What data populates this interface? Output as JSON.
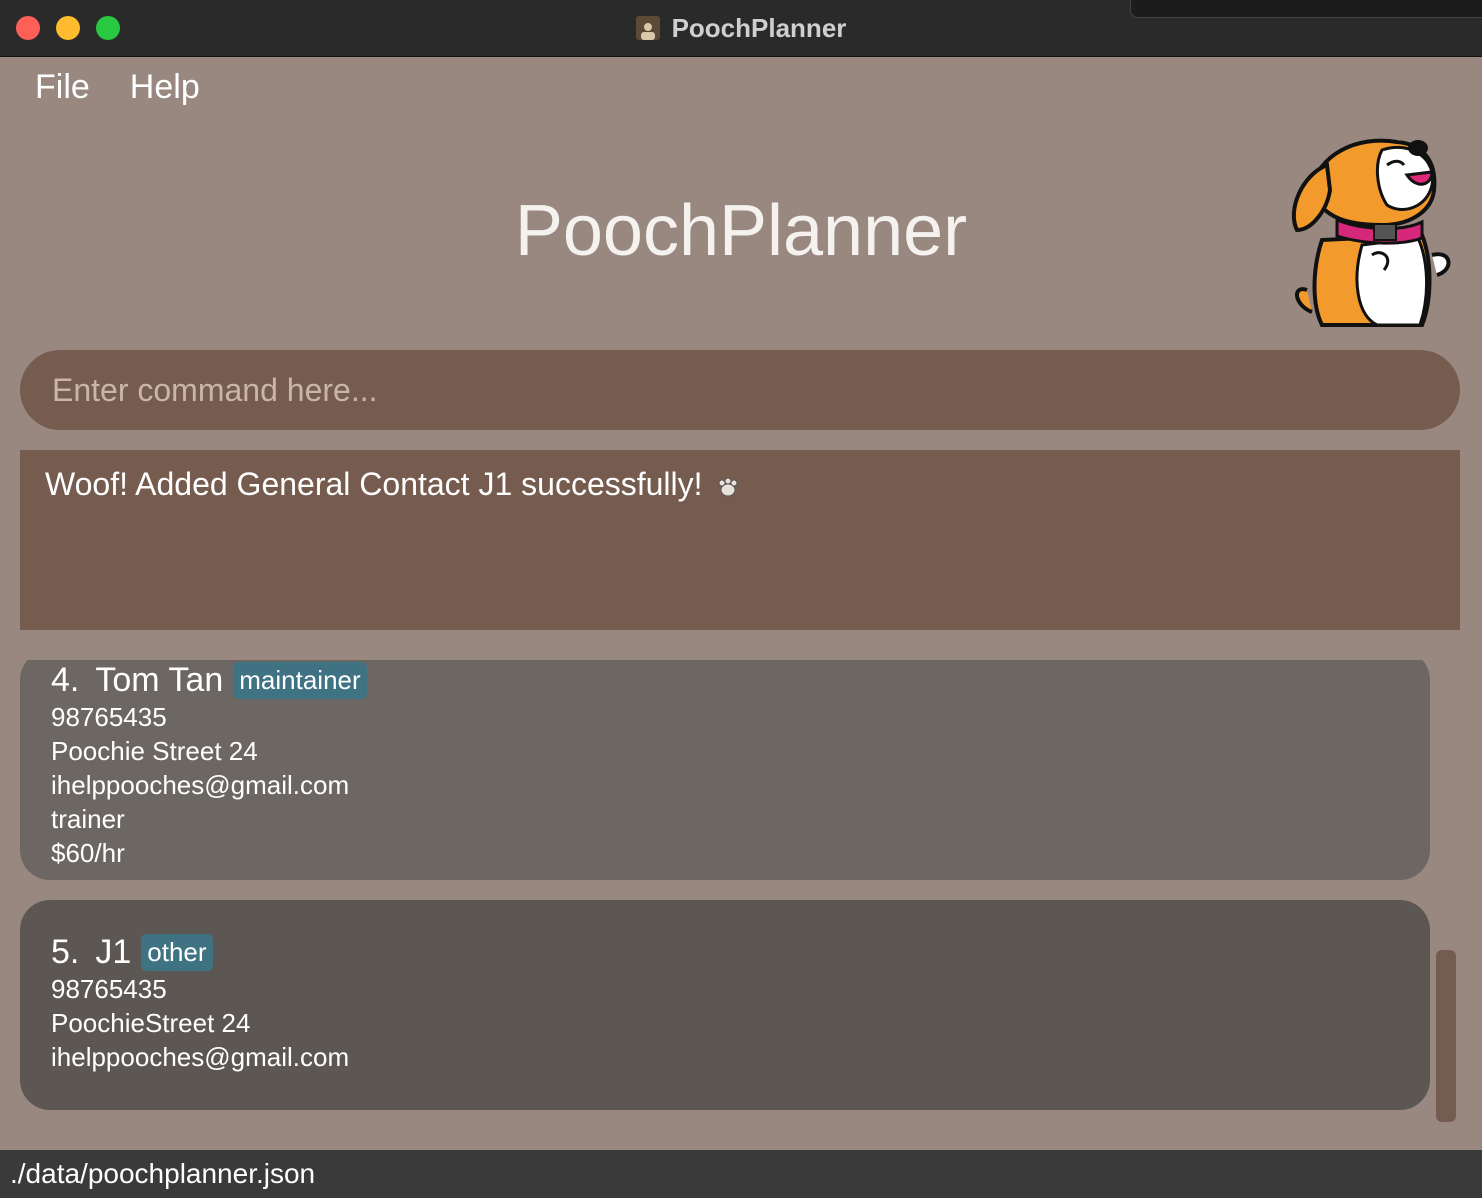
{
  "window": {
    "title": "PoochPlanner"
  },
  "menu": {
    "file": "File",
    "help": "Help"
  },
  "app": {
    "title": "PoochPlanner"
  },
  "command": {
    "placeholder": "Enter command here..."
  },
  "result": {
    "message": "Woof! Added General Contact J1 successfully!"
  },
  "contacts": [
    {
      "index": "4.",
      "name": "Tom Tan",
      "tag": "maintainer",
      "phone": "98765435",
      "address": "Poochie Street 24",
      "email": "ihelppooches@gmail.com",
      "skill": "trainer",
      "rate": "$60/hr"
    },
    {
      "index": "5.",
      "name": "J1",
      "tag": "other",
      "phone": "98765435",
      "address": "PoochieStreet 24",
      "email": "ihelppooches@gmail.com"
    }
  ],
  "status": {
    "path": "./data/poochplanner.json"
  },
  "icons": {
    "app": "person-card-icon",
    "result": "paw-icon",
    "mascot": "dog-mascot-icon"
  },
  "colors": {
    "background": "#988880",
    "command_box": "#765b4f",
    "card_a": "#6c6763",
    "card_b": "#5d5753",
    "tag": "#3f7283",
    "status_bar": "#3a3a3a"
  }
}
